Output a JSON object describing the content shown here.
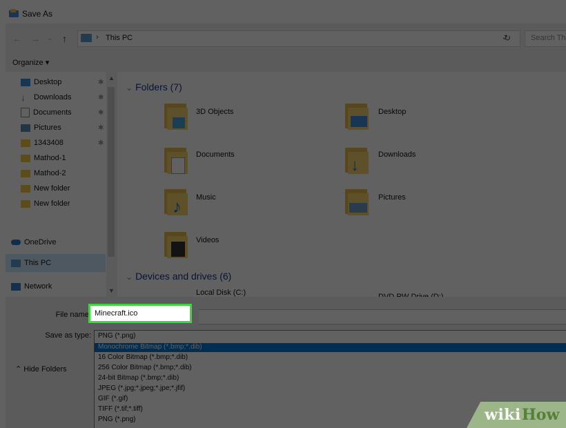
{
  "window": {
    "title": "Save As",
    "icon": "save-as-icon"
  },
  "address": {
    "path": "This PC",
    "separator": "›",
    "search_placeholder": "Search This PC",
    "nav_icons": [
      "back-arrow-icon",
      "forward-arrow-icon",
      "chevron-down-icon",
      "up-arrow-icon"
    ]
  },
  "toolbar": {
    "organize_label": "Organize ▾"
  },
  "sidebar": {
    "items": [
      {
        "label": "Desktop",
        "icon": "desktop-icon",
        "color": "#3a8fdc"
      },
      {
        "label": "Downloads",
        "icon": "download-icon",
        "color": "#2a7fd4"
      },
      {
        "label": "Documents",
        "icon": "document-icon",
        "color": "#cfcfcf"
      },
      {
        "label": "Pictures",
        "icon": "pictures-icon",
        "color": "#5a8bb5"
      },
      {
        "label": "1343408",
        "icon": "folder-icon",
        "color": "#f2c84b"
      },
      {
        "label": "Mathod-1",
        "icon": "folder-icon",
        "color": "#f2c84b"
      },
      {
        "label": "Mathod-2",
        "icon": "folder-icon",
        "color": "#f2c84b"
      },
      {
        "label": "New folder",
        "icon": "folder-icon",
        "color": "#f2c84b"
      },
      {
        "label": "New folder",
        "icon": "folder-icon",
        "color": "#f2c84b"
      }
    ],
    "onedrive": "OneDrive",
    "thispc": "This PC",
    "network": "Network"
  },
  "content": {
    "folders_header": "Folders (7)",
    "folders": [
      {
        "label": "3D Objects",
        "icon": "3d-objects-icon"
      },
      {
        "label": "Desktop",
        "icon": "desktop-folder-icon"
      },
      {
        "label": "Documents",
        "icon": "documents-folder-icon"
      },
      {
        "label": "Downloads",
        "icon": "downloads-folder-icon"
      },
      {
        "label": "Music",
        "icon": "music-folder-icon"
      },
      {
        "label": "Pictures",
        "icon": "pictures-folder-icon"
      },
      {
        "label": "Videos",
        "icon": "videos-folder-icon"
      }
    ],
    "devices_header": "Devices and drives (6)",
    "devices": [
      {
        "label": "Local Disk (C:)"
      },
      {
        "label": "DVD RW Drive (D:)"
      }
    ]
  },
  "form": {
    "file_name_label": "File name:",
    "file_name_value": "Minecraft.ico",
    "save_type_label": "Save as type:",
    "save_type_value": "PNG (*.png)",
    "options": [
      "Monochrome Bitmap (*.bmp;*.dib)",
      "16 Color Bitmap (*.bmp;*.dib)",
      "256 Color Bitmap (*.bmp;*.dib)",
      "24-bit Bitmap (*.bmp;*.dib)",
      "JPEG (*.jpg;*.jpeg;*.jpe;*.jfif)",
      "GIF (*.gif)",
      "TIFF (*.tif;*.tiff)",
      "PNG (*.png)"
    ],
    "selected_option": "Monochrome Bitmap (*.bmp;*.dib)",
    "hide_folders_label": "Hide Folders"
  },
  "colors": {
    "highlight": "#43d441",
    "selection": "#0078d7",
    "folder": "#f2c84b"
  },
  "watermark": {
    "part1": "wiki",
    "part2": "How"
  }
}
